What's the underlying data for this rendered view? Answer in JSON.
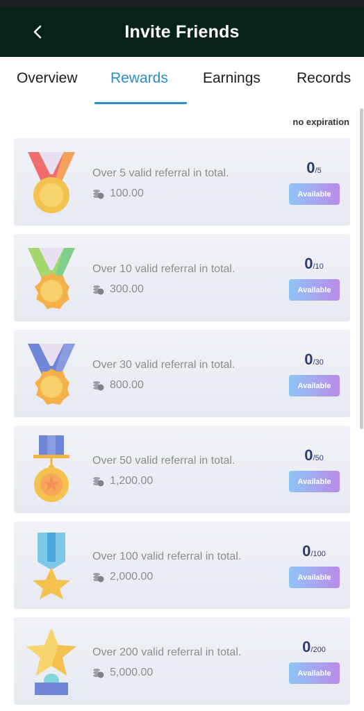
{
  "header": {
    "title": "Invite Friends",
    "back_icon": "back-arrow-icon"
  },
  "tabs": [
    {
      "label": "Overview",
      "active": false
    },
    {
      "label": "Rewards",
      "active": true
    },
    {
      "label": "Earnings",
      "active": false
    },
    {
      "label": "Records",
      "active": false
    }
  ],
  "expiration_note": "no expiration",
  "rewards": [
    {
      "description": "Over 5 valid referral in total.",
      "amount": "100.00",
      "current": "0",
      "target": "/5",
      "button": "Available",
      "medal": "red-ribbon-medal-icon"
    },
    {
      "description": "Over 10 valid referral in total.",
      "amount": "300.00",
      "current": "0",
      "target": "/10",
      "button": "Available",
      "medal": "green-ribbon-medal-icon"
    },
    {
      "description": "Over 30 valid referral in total.",
      "amount": "800.00",
      "current": "0",
      "target": "/30",
      "button": "Available",
      "medal": "blue-ribbon-medal-icon"
    },
    {
      "description": "Over 50 valid referral in total.",
      "amount": "1,200.00",
      "current": "0",
      "target": "/50",
      "button": "Available",
      "medal": "bar-medal-icon"
    },
    {
      "description": "Over 100 valid referral in total.",
      "amount": "2,000.00",
      "current": "0",
      "target": "/100",
      "button": "Available",
      "medal": "star-ribbon-medal-icon"
    },
    {
      "description": "Over 200 valid referral in total.",
      "amount": "5,000.00",
      "current": "0",
      "target": "/200",
      "button": "Available",
      "medal": "trophy-star-icon"
    }
  ],
  "colors": {
    "header_bg": "#062219",
    "accent": "#2b8ec7",
    "button_start": "#8ec5f5",
    "button_end": "#b98be8",
    "progress_text": "#2f3c6e"
  }
}
